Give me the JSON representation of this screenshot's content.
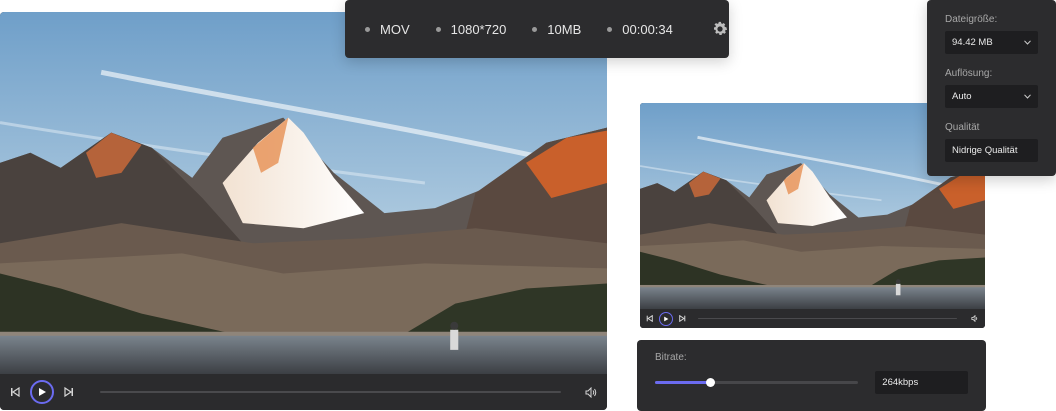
{
  "info_bar": {
    "items": [
      "MOV",
      "1080*720",
      "10MB",
      "00:00:34"
    ],
    "settings_icon": "gear-icon"
  },
  "main_player": {
    "controls": {
      "prev_icon": "skip-back-icon",
      "play_icon": "play-icon",
      "next_icon": "skip-forward-icon",
      "volume_icon": "volume-icon"
    }
  },
  "small_player": {
    "controls": {
      "prev_icon": "skip-back-icon",
      "play_icon": "play-icon",
      "next_icon": "skip-forward-icon",
      "volume_icon": "volume-icon"
    }
  },
  "settings": {
    "file_size_label": "Dateigröße:",
    "file_size_value": "94.42 MB",
    "resolution_label": "Auflösung:",
    "resolution_value": "Auto",
    "quality_label": "Qualität",
    "quality_value": "Nidrige Qualität"
  },
  "bitrate": {
    "label": "Bitrate:",
    "value": "264kbps",
    "slider_fraction": 0.27
  },
  "colors": {
    "accent": "#6b6bf0",
    "panel": "#2c2c2e",
    "field": "#1e1e20"
  }
}
